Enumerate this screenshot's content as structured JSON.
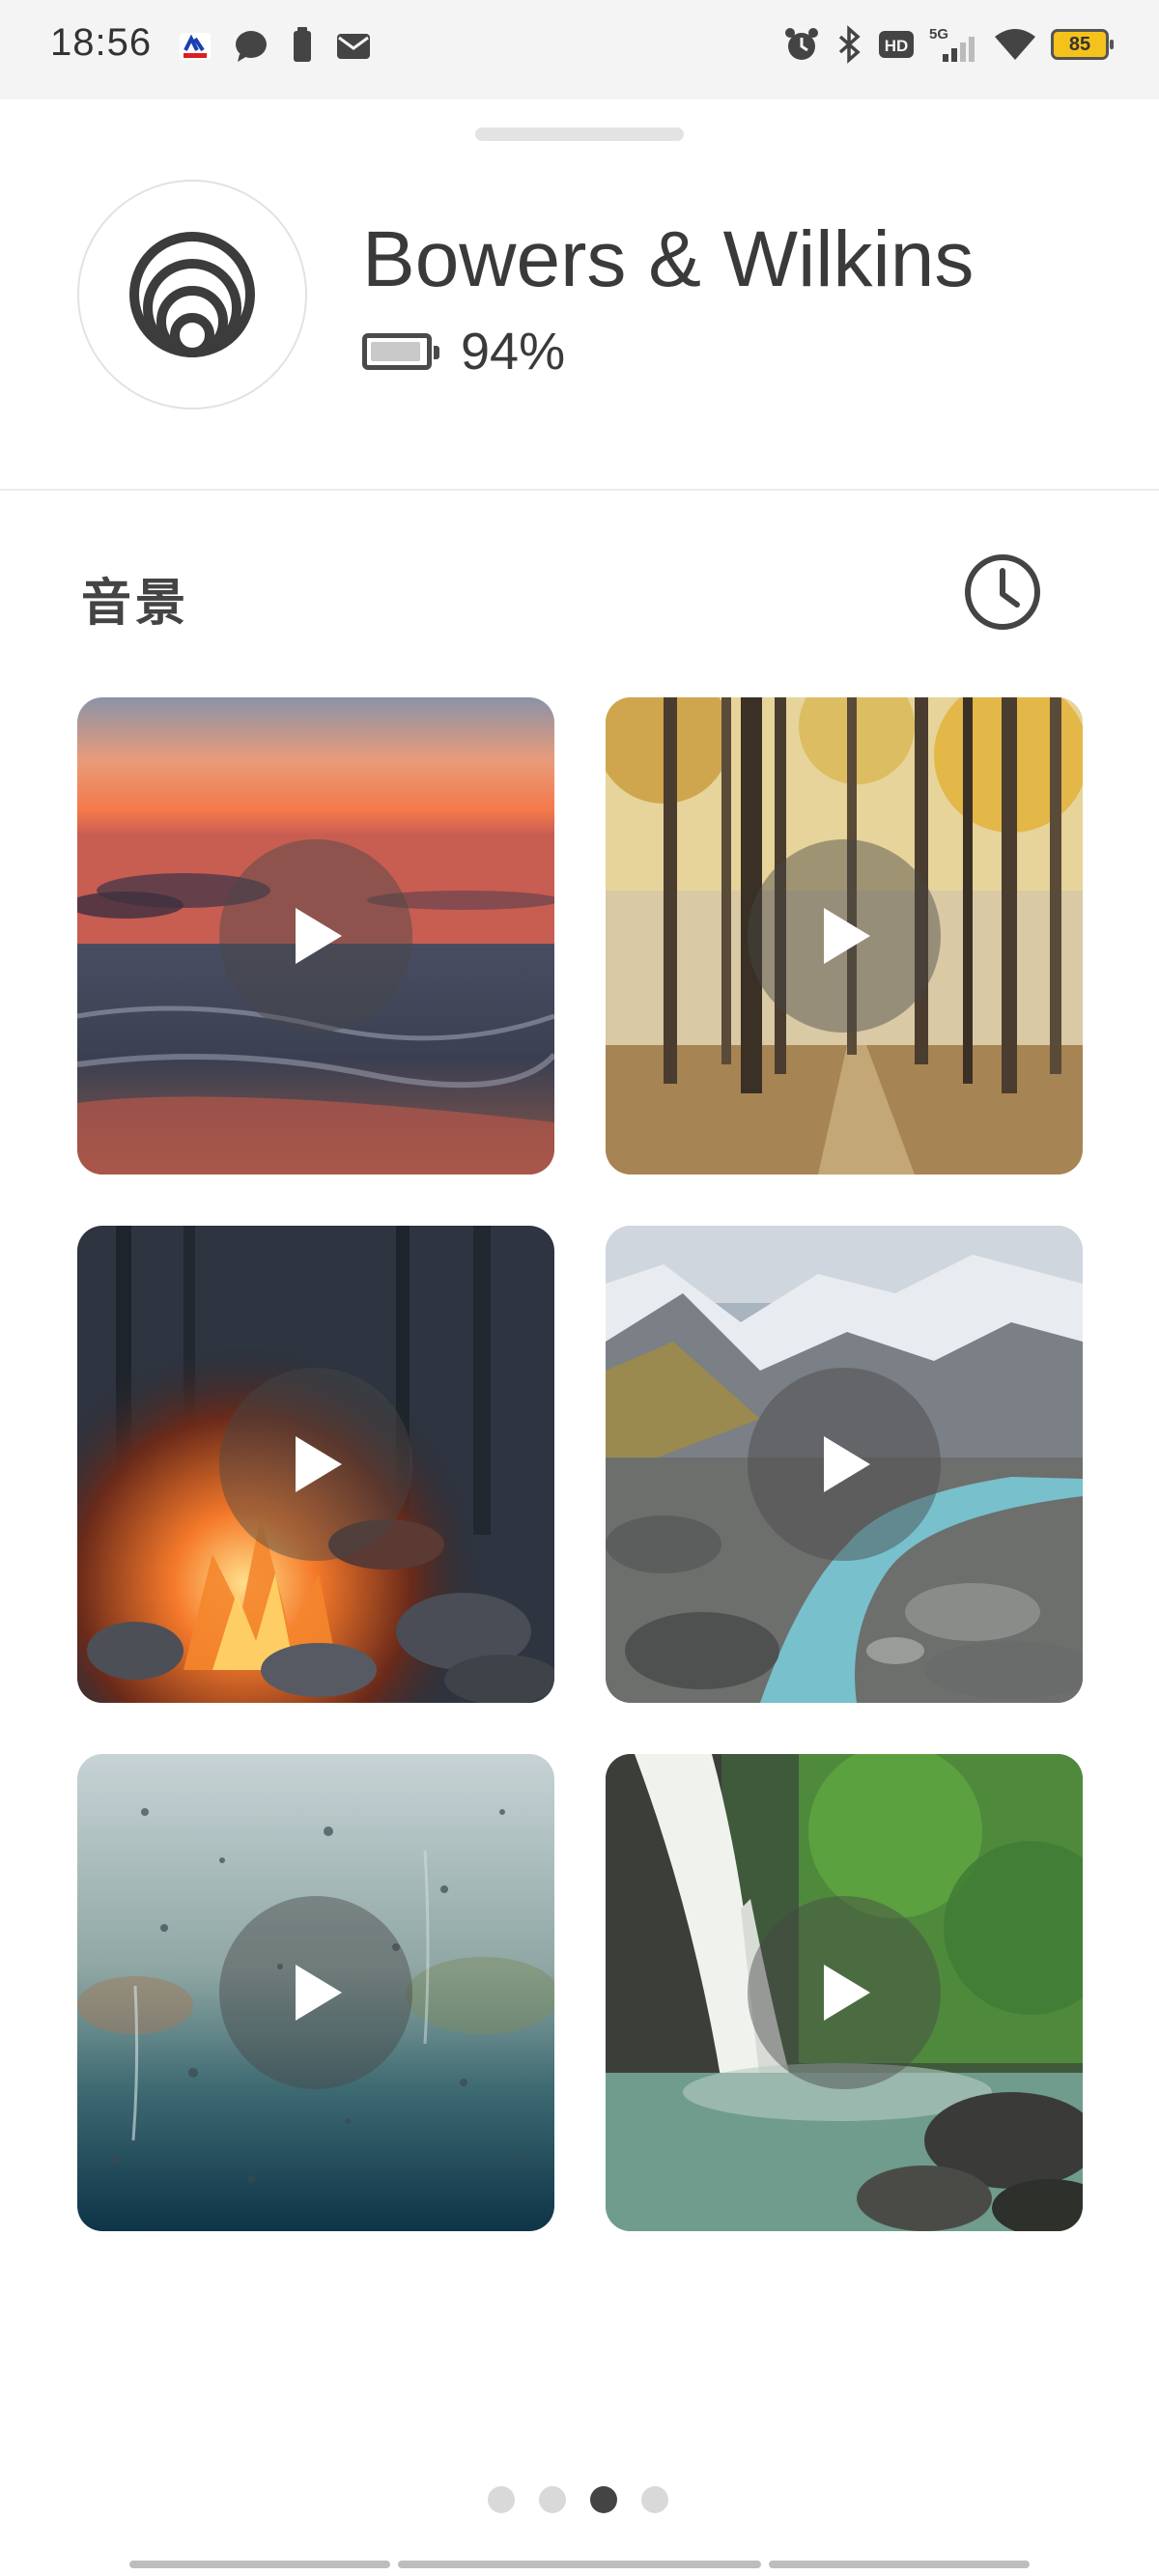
{
  "status_bar": {
    "time": "18:56",
    "battery_level": "85",
    "network": "5G",
    "hd_label": "HD"
  },
  "device": {
    "name": "Bowers & Wilkins",
    "battery_percent": "94%",
    "battery_fill_fraction": 0.94
  },
  "section": {
    "title": "音景",
    "history_icon": "clock-icon"
  },
  "soundscapes": [
    {
      "scene": "sunset-ocean",
      "icon": "play-icon"
    },
    {
      "scene": "autumn-forest",
      "icon": "play-icon"
    },
    {
      "scene": "campfire",
      "icon": "play-icon"
    },
    {
      "scene": "mountain-stream",
      "icon": "play-icon"
    },
    {
      "scene": "rain-window",
      "icon": "play-icon"
    },
    {
      "scene": "waterfall",
      "icon": "play-icon"
    }
  ],
  "pager": {
    "total": 4,
    "active": 3
  },
  "colors": {
    "accent_dark": "#444444",
    "battery_badge": "#f5c21b",
    "divider": "#ececec"
  }
}
